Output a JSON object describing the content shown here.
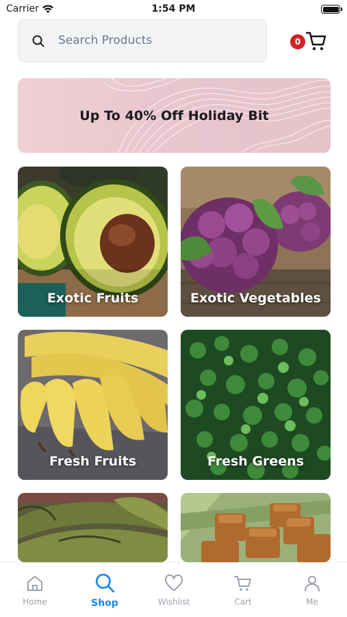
{
  "status_bar": {
    "carrier": "Carrier",
    "time": "1:54 PM"
  },
  "search": {
    "placeholder": "Search Products",
    "icon": "search-icon"
  },
  "cart": {
    "count": "0",
    "icon": "cart-icon",
    "badge_color": "#d32222"
  },
  "promo": {
    "text": "Up To 40%  Off Holiday Bit"
  },
  "categories": [
    {
      "label": "Exotic Fruits"
    },
    {
      "label": "Exotic Vegetables"
    },
    {
      "label": "Fresh Fruits"
    },
    {
      "label": "Fresh Greens"
    },
    {
      "label": ""
    },
    {
      "label": ""
    }
  ],
  "tabs": [
    {
      "label": "Home",
      "icon": "home-icon"
    },
    {
      "label": "Shop",
      "icon": "search-icon",
      "active": true
    },
    {
      "label": "Wishlist",
      "icon": "heart-icon"
    },
    {
      "label": "Cart",
      "icon": "cart-icon"
    },
    {
      "label": "Me",
      "icon": "user-icon"
    }
  ],
  "colors": {
    "accent": "#1e88e5",
    "inactive": "#9aa1ab"
  }
}
